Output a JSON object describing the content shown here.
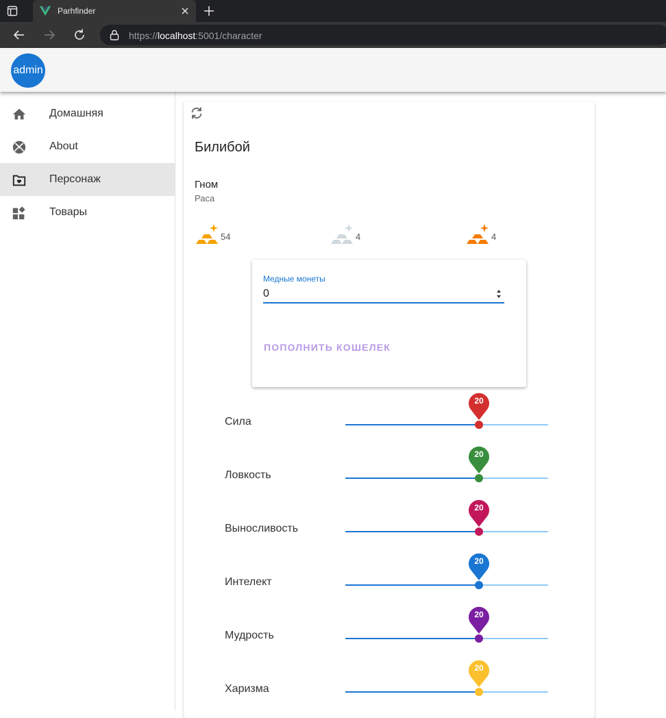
{
  "browser": {
    "tab_title": "Parhfinder",
    "url_prefix": "https://",
    "url_host": "localhost",
    "url_rest": ":5001/character"
  },
  "appbar": {
    "avatar_text": "admin",
    "avatar_color": "#1976d2"
  },
  "sidebar": {
    "items": [
      {
        "label": "Домашняя",
        "icon": "home-icon"
      },
      {
        "label": "About",
        "icon": "xbox-icon"
      },
      {
        "label": "Персонаж",
        "icon": "folder-heart-icon",
        "active": true
      },
      {
        "label": "Товары",
        "icon": "widgets-icon"
      }
    ]
  },
  "character": {
    "name": "Билибой",
    "race_value": "Гном",
    "race_label": "Раса"
  },
  "coins": [
    {
      "icon": "gold-coins-icon",
      "count": "54",
      "color": "#f4a300"
    },
    {
      "icon": "silver-coins-icon",
      "count": "4",
      "color": "#cfd8dc"
    },
    {
      "icon": "copper-coins-icon",
      "count": "4",
      "color": "#f57c00"
    }
  ],
  "wallet": {
    "field_label": "Медные монеты",
    "field_value": "0",
    "button_label": "ПОПОЛНИТЬ КОШЕЛЕК"
  },
  "stats": [
    {
      "label": "Сила",
      "value": "20",
      "fraction": 0.66,
      "color": "#d32f2f"
    },
    {
      "label": "Ловкость",
      "value": "20",
      "fraction": 0.66,
      "color": "#388e3c"
    },
    {
      "label": "Выносливость",
      "value": "20",
      "fraction": 0.66,
      "color": "#c2185b"
    },
    {
      "label": "Интелект",
      "value": "20",
      "fraction": 0.66,
      "color": "#1976d2"
    },
    {
      "label": "Мудрость",
      "value": "20",
      "fraction": 0.66,
      "color": "#7b1fa2"
    },
    {
      "label": "Харизма",
      "value": "20",
      "fraction": 0.66,
      "color": "#fbc02d"
    }
  ]
}
